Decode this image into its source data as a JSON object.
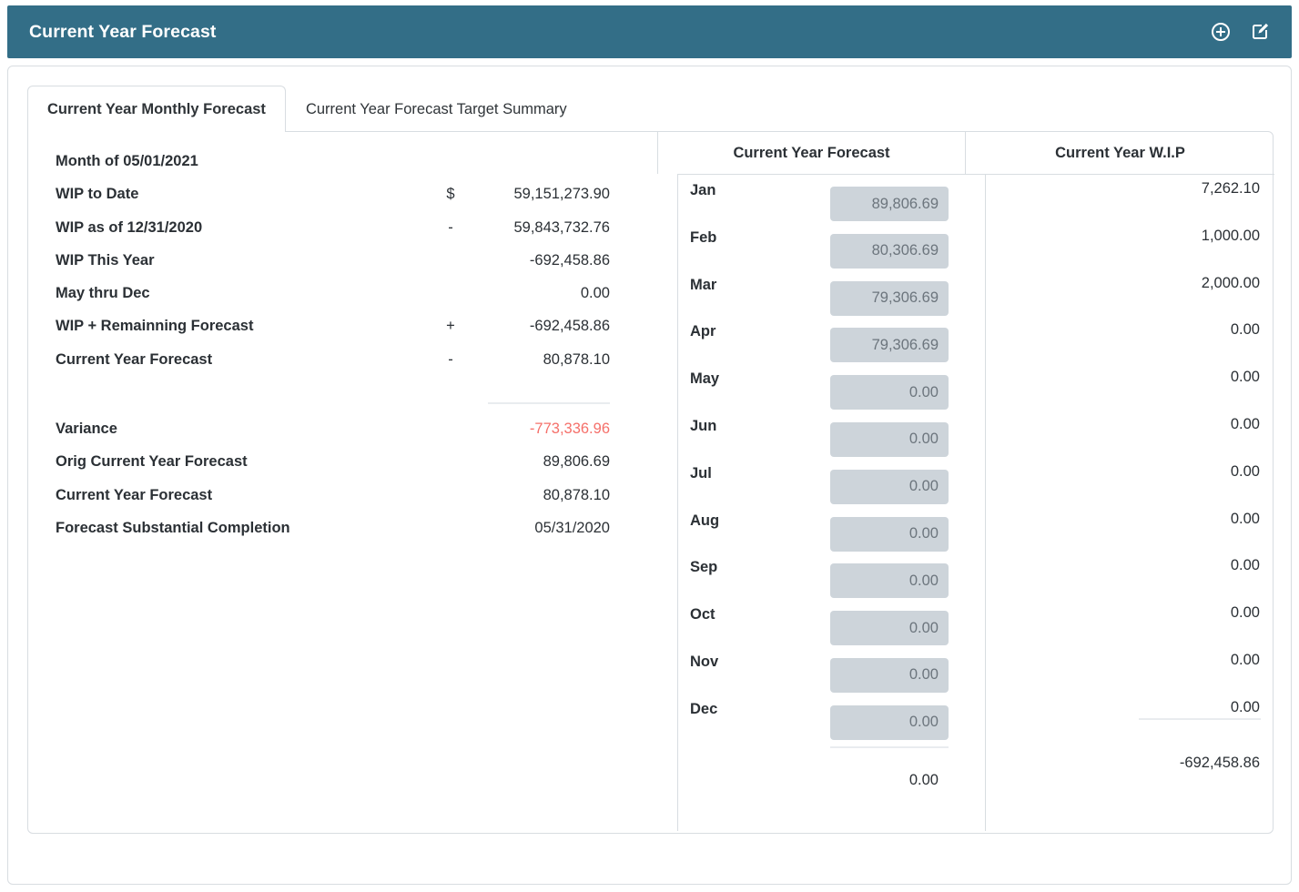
{
  "header": {
    "title": "Current Year Forecast",
    "accent_color": "#336e87",
    "add_icon": "plus-circle-icon",
    "edit_icon": "edit-square-icon"
  },
  "tabs": [
    {
      "label": "Current Year Monthly Forecast",
      "active": true
    },
    {
      "label": "Current Year Forecast Target Summary",
      "active": false
    }
  ],
  "summary": {
    "rows": [
      {
        "label": "Month of 05/01/2021",
        "sign": "",
        "value": ""
      },
      {
        "label": "WIP to Date",
        "sign": "$",
        "value": "59,151,273.90"
      },
      {
        "label": "WIP as of 12/31/2020",
        "sign": "-",
        "value": "59,843,732.76"
      },
      {
        "label": "WIP This Year",
        "sign": "",
        "value": "-692,458.86"
      },
      {
        "label": "May thru Dec",
        "sign": "",
        "value": "0.00"
      },
      {
        "label": "WIP + Remainning Forecast",
        "sign": "+",
        "value": "-692,458.86"
      },
      {
        "label": "Current Year Forecast",
        "sign": "-",
        "value": "80,878.10"
      }
    ],
    "rows_after_rule": [
      {
        "label": "Variance",
        "sign": "",
        "value": "-773,336.96",
        "negative": true
      },
      {
        "label": "Orig Current Year Forecast",
        "sign": "",
        "value": "89,806.69",
        "negative": false
      },
      {
        "label": "Current Year Forecast",
        "sign": "",
        "value": "80,878.10",
        "negative": false
      },
      {
        "label": "Forecast Substantial Completion",
        "sign": "",
        "value": "05/31/2020",
        "negative": false
      }
    ],
    "negative_color": "#f5706a"
  },
  "monthly_table": {
    "column_headers": {
      "forecast": "Current Year Forecast",
      "wip": "Current Year W.I.P"
    },
    "rows": [
      {
        "month": "Jan",
        "forecast": "89,806.69",
        "wip": "7,262.10"
      },
      {
        "month": "Feb",
        "forecast": "80,306.69",
        "wip": "1,000.00"
      },
      {
        "month": "Mar",
        "forecast": "79,306.69",
        "wip": "2,000.00"
      },
      {
        "month": "Apr",
        "forecast": "79,306.69",
        "wip": "0.00"
      },
      {
        "month": "May",
        "forecast": "0.00",
        "wip": "0.00"
      },
      {
        "month": "Jun",
        "forecast": "0.00",
        "wip": "0.00"
      },
      {
        "month": "Jul",
        "forecast": "0.00",
        "wip": "0.00"
      },
      {
        "month": "Aug",
        "forecast": "0.00",
        "wip": "0.00"
      },
      {
        "month": "Sep",
        "forecast": "0.00",
        "wip": "0.00"
      },
      {
        "month": "Oct",
        "forecast": "0.00",
        "wip": "0.00"
      },
      {
        "month": "Nov",
        "forecast": "0.00",
        "wip": "0.00"
      },
      {
        "month": "Dec",
        "forecast": "0.00",
        "wip": "0.00"
      }
    ],
    "totals": {
      "forecast": "0.00",
      "wip": "-692,458.86"
    }
  }
}
